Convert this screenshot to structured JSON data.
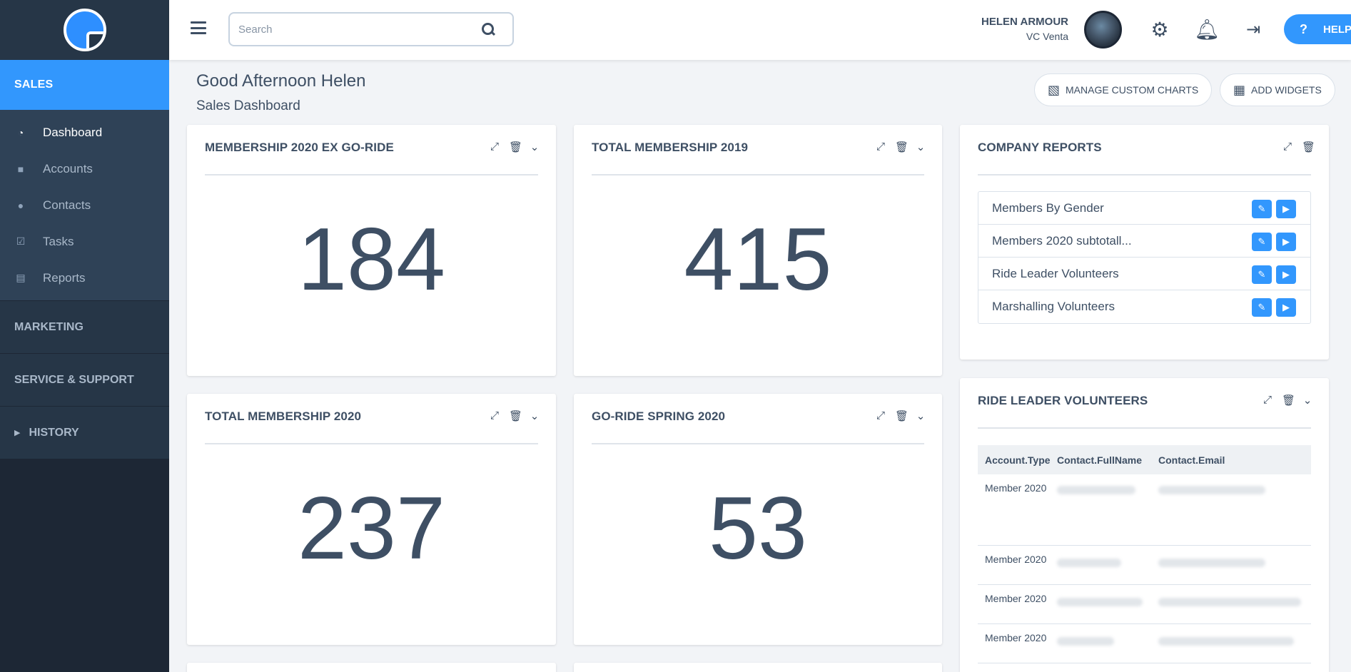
{
  "sidebar": {
    "section_sales": "SALES",
    "items": [
      {
        "label": "Dashboard",
        "icon": "dashboard-icon"
      },
      {
        "label": "Accounts",
        "icon": "briefcase-icon"
      },
      {
        "label": "Contacts",
        "icon": "users-icon"
      },
      {
        "label": "Tasks",
        "icon": "check-square-icon"
      },
      {
        "label": "Reports",
        "icon": "reports-icon"
      }
    ],
    "section_marketing": "MARKETING",
    "section_service": "SERVICE & SUPPORT",
    "section_history": "HISTORY"
  },
  "topbar": {
    "search_placeholder": "Search",
    "user_name": "HELEN ARMOUR",
    "user_org": "VC Venta",
    "help_label": "HELP"
  },
  "header": {
    "greeting": "Good Afternoon Helen",
    "subtitle": "Sales Dashboard",
    "manage_charts": "MANAGE CUSTOM CHARTS",
    "add_widgets": "ADD WIDGETS"
  },
  "widgets": {
    "w1": {
      "title": "MEMBERSHIP 2020 EX GO-RIDE",
      "value": "184"
    },
    "w2": {
      "title": "TOTAL MEMBERSHIP 2019",
      "value": "415"
    },
    "w3": {
      "title": "TOTAL MEMBERSHIP 2020",
      "value": "237"
    },
    "w4": {
      "title": "GO-RIDE SPRING 2020",
      "value": "53"
    }
  },
  "company_reports": {
    "title": "COMPANY REPORTS",
    "items": [
      "Members By Gender",
      "Members 2020 subtotall...",
      "Ride Leader Volunteers",
      "Marshalling Volunteers"
    ]
  },
  "ride_leaders": {
    "title": "RIDE LEADER VOLUNTEERS",
    "columns": [
      "Account.Type",
      "Contact.FullName",
      "Contact.Email"
    ],
    "rows": [
      "Member 2020",
      "Member 2020",
      "Member 2020",
      "Member 2020"
    ]
  },
  "colors": {
    "accent": "#3297fd",
    "sidebar": "#1d2735",
    "text": "#3e4f64"
  }
}
